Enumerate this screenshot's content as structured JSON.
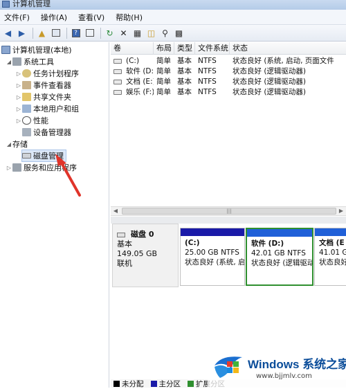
{
  "window": {
    "title": "计算机管理"
  },
  "menu": [
    "文件(F)",
    "操作(A)",
    "查看(V)",
    "帮助(H)"
  ],
  "toolbar": [
    "back-icon",
    "forward-icon",
    "up-folder-icon",
    "show-tree-icon",
    "help-icon",
    "properties-panel-icon",
    "refresh-icon",
    "delete-icon",
    "properties-icon",
    "open-icon",
    "search-icon",
    "view-icon"
  ],
  "tree": {
    "root": "计算机管理(本地)",
    "system_tools": "系统工具",
    "task_scheduler": "任务计划程序",
    "event_viewer": "事件查看器",
    "shared_folders": "共享文件夹",
    "local_users": "本地用户和组",
    "performance": "性能",
    "device_manager": "设备管理器",
    "storage": "存储",
    "disk_management": "磁盘管理",
    "services": "服务和应用程序"
  },
  "volumes": {
    "headers": [
      "卷",
      "布局",
      "类型",
      "文件系统",
      "状态"
    ],
    "rows": [
      {
        "name": "(C:)",
        "layout": "简单",
        "type": "基本",
        "fs": "NTFS",
        "status": "状态良好 (系统, 启动, 页面文件"
      },
      {
        "name": "软件 (D:)",
        "layout": "简单",
        "type": "基本",
        "fs": "NTFS",
        "status": "状态良好 (逻辑驱动器)"
      },
      {
        "name": "文档 (E:)",
        "layout": "简单",
        "type": "基本",
        "fs": "NTFS",
        "status": "状态良好 (逻辑驱动器)"
      },
      {
        "name": "娱乐 (F:)",
        "layout": "简单",
        "type": "基本",
        "fs": "NTFS",
        "status": "状态良好 (逻辑驱动器)"
      }
    ]
  },
  "scroll_thumb_grip": "|||",
  "disk": {
    "name": "磁盘 0",
    "type": "基本",
    "size": "149.05 GB",
    "status": "联机",
    "partitions": [
      {
        "title": "(C:)",
        "size": "25.00 GB NTFS",
        "status": "状态良好 (系统, 启"
      },
      {
        "title": "软件  (D:)",
        "size": "42.01 GB NTFS",
        "status": "状态良好 (逻辑驱动"
      },
      {
        "title": "文档  (E",
        "size": "41.01 GB N",
        "status": "状态良好"
      }
    ]
  },
  "legend": [
    {
      "label": "未分配",
      "color": "#000000"
    },
    {
      "label": "主分区",
      "color": "#1a1aa8"
    },
    {
      "label": "扩展分区",
      "color": "#2f8f2f"
    }
  ],
  "watermark": {
    "brand": "Windows",
    "site": "系统之家",
    "url": "www.bjjmlv.com"
  }
}
